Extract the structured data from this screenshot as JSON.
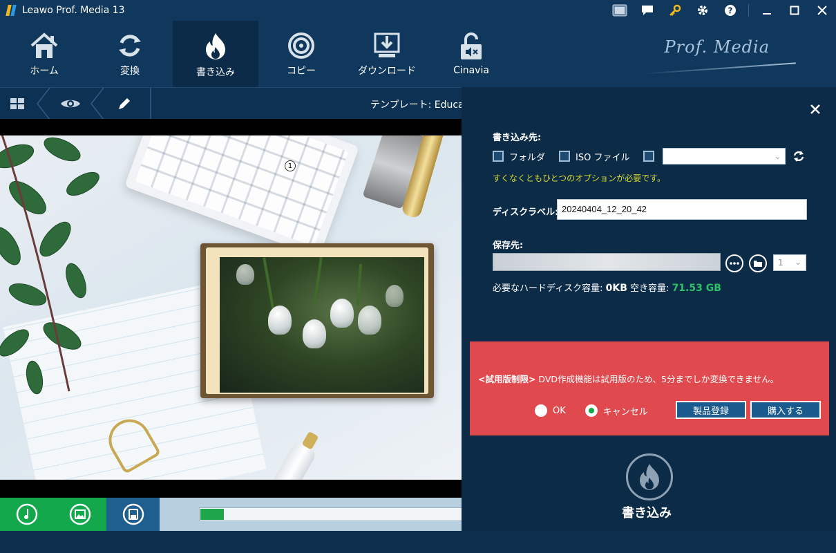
{
  "window": {
    "title": "Leawo Prof. Media 13"
  },
  "nav": {
    "items": [
      {
        "label": "ホーム",
        "icon": "home-icon"
      },
      {
        "label": "変換",
        "icon": "convert-icon"
      },
      {
        "label": "書き込み",
        "icon": "burn-icon",
        "active": true
      },
      {
        "label": "コピー",
        "icon": "copy-disc-icon"
      },
      {
        "label": "ダウンロード",
        "icon": "download-icon"
      },
      {
        "label": "Cinavia",
        "icon": "cinavia-icon"
      }
    ],
    "brand": "Prof. Media"
  },
  "subbar": {
    "template_label": "テンプレート: Educat"
  },
  "preview": {
    "page_number": "1"
  },
  "bottom": {
    "progress": 0.09
  },
  "panel": {
    "burn_to_label": "書き込み先:",
    "options": [
      {
        "label": "フォルダ",
        "checked": false
      },
      {
        "label": "ISO ファイル",
        "checked": false
      }
    ],
    "option_warning": "すくなくともひとつのオプションが必要です。",
    "disc_label_label": "ディスクラベル:",
    "disc_label_value": "20240404_12_20_42",
    "save_to_label": "保存先:",
    "copies_value": "1",
    "required_space_label": "必要なハードディスク容量:",
    "required_space_value": "0KB",
    "free_space_label": "空き容量:",
    "free_space_value": "71.53 GB",
    "trial": {
      "tag": "<試用版制限>",
      "message": " DVD作成機能は試用版のため、5分までしか変換できません。",
      "ok_label": "OK",
      "cancel_label": "キャンセル",
      "selected": "cancel",
      "register_label": "製品登録",
      "buy_label": "購入する"
    },
    "burn_label": "書き込み"
  },
  "colors": {
    "nav_bg": "#10385c",
    "panel_bg": "#0b2b47",
    "trial_bg": "#e04a4f",
    "green": "#13a84c",
    "free_space": "#2ec266"
  }
}
